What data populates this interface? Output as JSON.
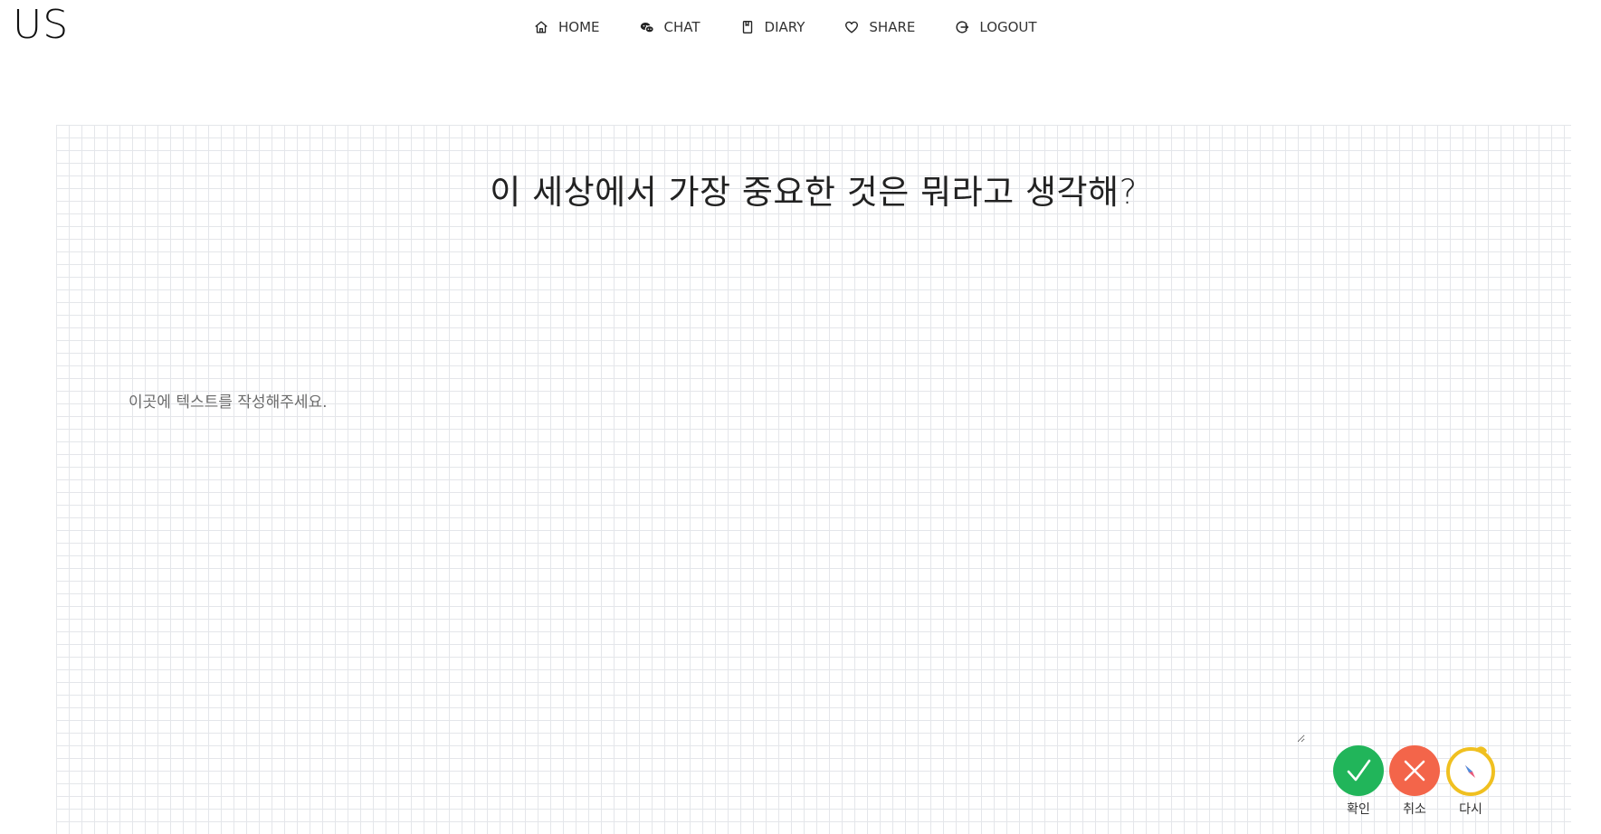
{
  "app": {
    "logo": "US"
  },
  "nav": {
    "items": [
      {
        "label": "HOME",
        "icon": "home-icon"
      },
      {
        "label": "CHAT",
        "icon": "chat-bubbles-icon"
      },
      {
        "label": "DIARY",
        "icon": "diary-book-icon"
      },
      {
        "label": "SHARE",
        "icon": "heart-icon"
      },
      {
        "label": "LOGOUT",
        "icon": "logout-icon"
      }
    ]
  },
  "board": {
    "question": "이 세상에서 가장 중요한 것은 뭐라고 생각해?",
    "answer": {
      "value": "",
      "placeholder": "이곳에 텍스트를 작성해주세요."
    }
  },
  "actions": {
    "confirm": {
      "label": "확인",
      "icon": "checkmark-icon",
      "color": "#21b55a"
    },
    "cancel": {
      "label": "취소",
      "icon": "close-x-icon",
      "color": "#f3654a"
    },
    "retry": {
      "label": "다시",
      "icon": "compass-icon",
      "color": "#f0c020"
    }
  }
}
